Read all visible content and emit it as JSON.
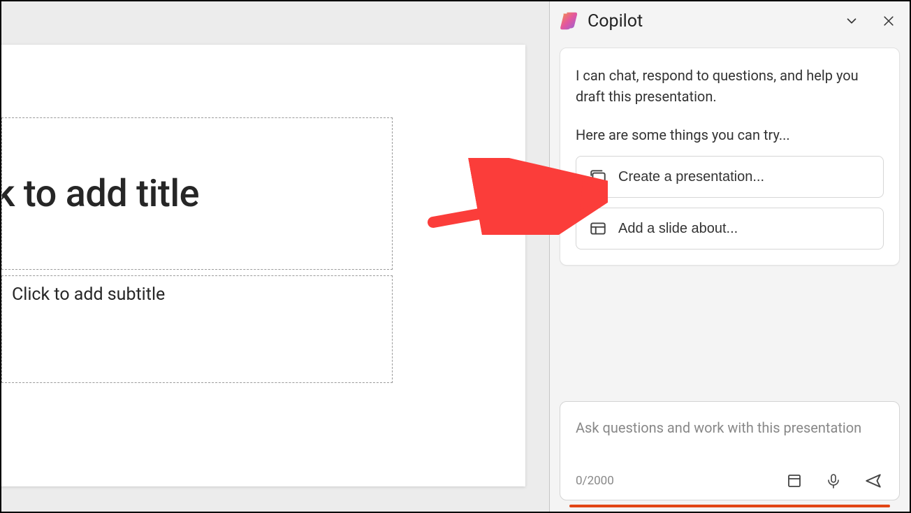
{
  "slide": {
    "title_placeholder": "lick to add title",
    "subtitle_placeholder": "Click to add subtitle"
  },
  "copilot": {
    "title": "Copilot",
    "intro": "I can chat, respond to questions, and help you draft this presentation.",
    "prompt": "Here are some things you can try...",
    "suggestions": [
      {
        "label": "Create a presentation..."
      },
      {
        "label": "Add a slide about..."
      }
    ],
    "input": {
      "placeholder": "Ask questions and work with this presentation",
      "counter": "0/2000"
    }
  },
  "colors": {
    "accent": "#e24615",
    "arrow": "#fb3d3a"
  }
}
